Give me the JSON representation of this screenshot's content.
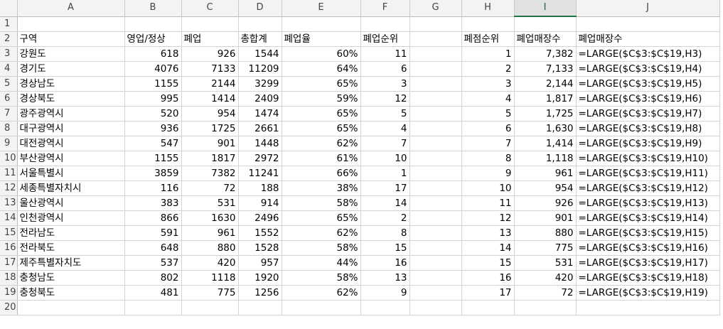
{
  "columns": [
    "A",
    "B",
    "C",
    "D",
    "E",
    "F",
    "G",
    "H",
    "I",
    "J"
  ],
  "selected_column": "I",
  "row_numbers": [
    "1",
    "2",
    "3",
    "4",
    "5",
    "6",
    "7",
    "8",
    "9",
    "10",
    "11",
    "12",
    "13",
    "14",
    "15",
    "16",
    "17",
    "18",
    "19",
    "20"
  ],
  "headers": [
    "구역",
    "영업/정상",
    "폐업",
    "총합계",
    "폐업율",
    "폐업순위",
    "",
    "폐점순위",
    "폐업매장수",
    "폐업매장수"
  ],
  "rows": [
    [
      "강원도",
      "618",
      "926",
      "1544",
      "60%",
      "11",
      "",
      "1",
      "7,382",
      "=LARGE($C$3:$C$19,H3)"
    ],
    [
      "경기도",
      "4076",
      "7133",
      "11209",
      "64%",
      "6",
      "",
      "2",
      "7,133",
      "=LARGE($C$3:$C$19,H4)"
    ],
    [
      "경상남도",
      "1155",
      "2144",
      "3299",
      "65%",
      "3",
      "",
      "3",
      "2,144",
      "=LARGE($C$3:$C$19,H5)"
    ],
    [
      "경상북도",
      "995",
      "1414",
      "2409",
      "59%",
      "12",
      "",
      "4",
      "1,817",
      "=LARGE($C$3:$C$19,H6)"
    ],
    [
      "광주광역시",
      "520",
      "954",
      "1474",
      "65%",
      "5",
      "",
      "5",
      "1,725",
      "=LARGE($C$3:$C$19,H7)"
    ],
    [
      "대구광역시",
      "936",
      "1725",
      "2661",
      "65%",
      "4",
      "",
      "6",
      "1,630",
      "=LARGE($C$3:$C$19,H8)"
    ],
    [
      "대전광역시",
      "547",
      "901",
      "1448",
      "62%",
      "7",
      "",
      "7",
      "1,414",
      "=LARGE($C$3:$C$19,H9)"
    ],
    [
      "부산광역시",
      "1155",
      "1817",
      "2972",
      "61%",
      "10",
      "",
      "8",
      "1,118",
      "=LARGE($C$3:$C$19,H10)"
    ],
    [
      "서울특별시",
      "3859",
      "7382",
      "11241",
      "66%",
      "1",
      "",
      "9",
      "961",
      "=LARGE($C$3:$C$19,H11)"
    ],
    [
      "세종특별자치시",
      "116",
      "72",
      "188",
      "38%",
      "17",
      "",
      "10",
      "954",
      "=LARGE($C$3:$C$19,H12)"
    ],
    [
      "울산광역시",
      "383",
      "531",
      "914",
      "58%",
      "14",
      "",
      "11",
      "926",
      "=LARGE($C$3:$C$19,H13)"
    ],
    [
      "인천광역시",
      "866",
      "1630",
      "2496",
      "65%",
      "2",
      "",
      "12",
      "901",
      "=LARGE($C$3:$C$19,H14)"
    ],
    [
      "전라남도",
      "591",
      "961",
      "1552",
      "62%",
      "8",
      "",
      "13",
      "880",
      "=LARGE($C$3:$C$19,H15)"
    ],
    [
      "전라북도",
      "648",
      "880",
      "1528",
      "58%",
      "15",
      "",
      "14",
      "775",
      "=LARGE($C$3:$C$19,H16)"
    ],
    [
      "제주특별자치도",
      "537",
      "420",
      "957",
      "44%",
      "16",
      "",
      "15",
      "531",
      "=LARGE($C$3:$C$19,H17)"
    ],
    [
      "충청남도",
      "802",
      "1118",
      "1920",
      "58%",
      "13",
      "",
      "16",
      "420",
      "=LARGE($C$3:$C$19,H18)"
    ],
    [
      "충청북도",
      "481",
      "775",
      "1256",
      "62%",
      "9",
      "",
      "17",
      "72",
      "=LARGE($C$3:$C$19,H19)"
    ]
  ]
}
